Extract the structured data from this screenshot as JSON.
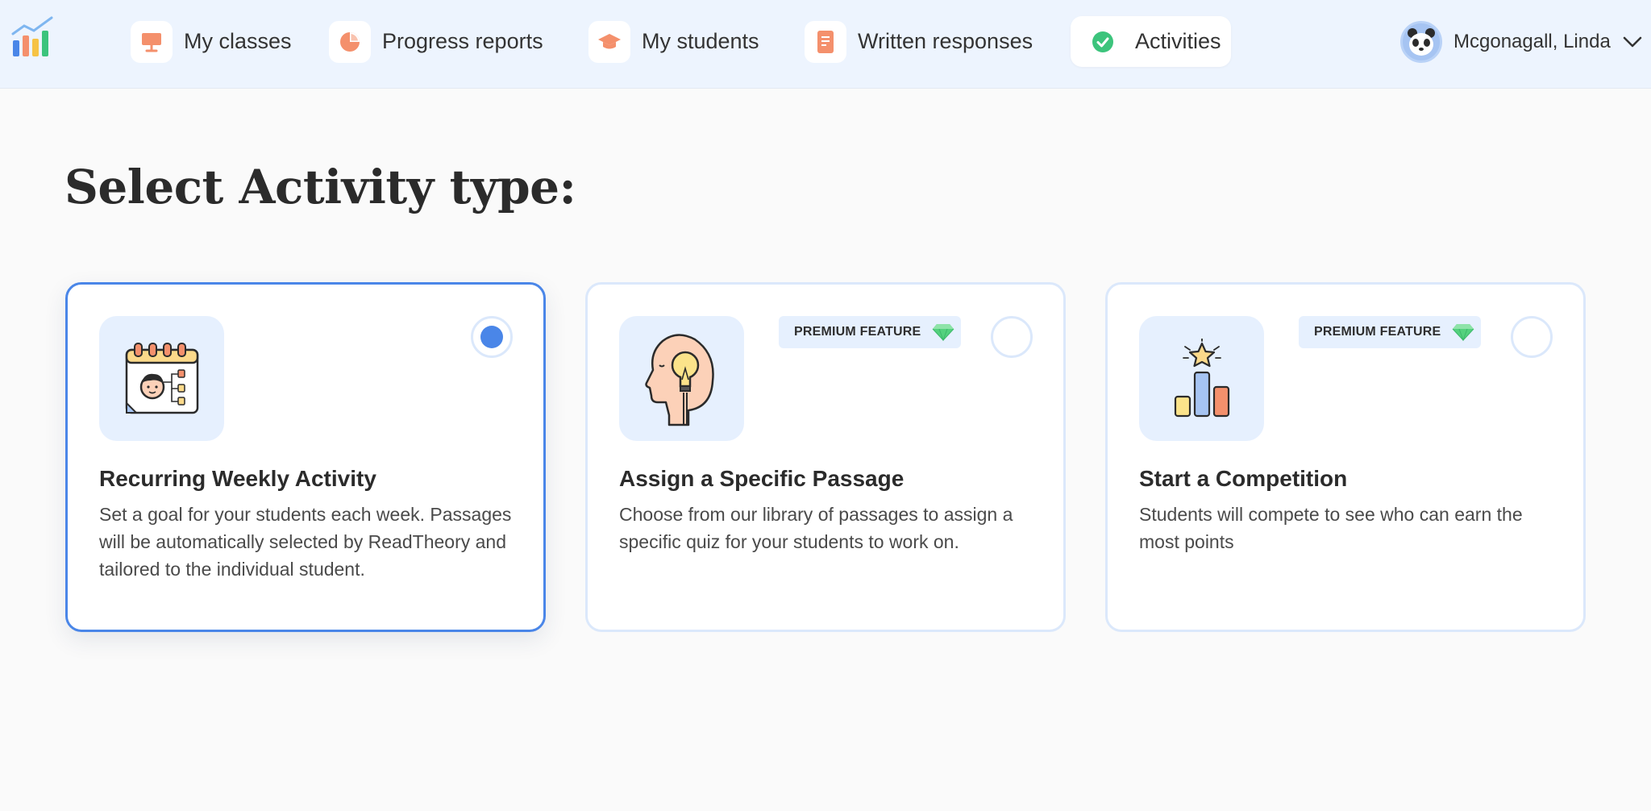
{
  "nav": {
    "items": [
      {
        "label": "My classes",
        "icon": "presentation-board-icon"
      },
      {
        "label": "Progress reports",
        "icon": "pie-chart-icon"
      },
      {
        "label": "My students",
        "icon": "graduation-cap-icon"
      },
      {
        "label": "Written responses",
        "icon": "document-icon"
      },
      {
        "label": "Activities",
        "icon": "check-circle-icon",
        "active": true
      }
    ],
    "user_name": "Mcgonagall, Linda"
  },
  "page": {
    "title": "Select Activity type:"
  },
  "cards": [
    {
      "title": "Recurring Weekly Activity",
      "description": "Set a goal for your students each week. Passages will be automatically selected by ReadTheory and tailored to the individual student.",
      "selected": true,
      "icon": "calendar-student-icon"
    },
    {
      "title": "Assign a Specific Passage",
      "description": "Choose from our library of passages to assign a specific quiz for your students to work on.",
      "badge": "PREMIUM FEATURE",
      "selected": false,
      "icon": "head-lightbulb-icon"
    },
    {
      "title": "Start a Competition",
      "description": "Students will compete to see who can earn the most points",
      "badge": "PREMIUM FEATURE",
      "selected": false,
      "icon": "podium-star-icon"
    }
  ],
  "colors": {
    "accent": "#4a86e8",
    "nav_bg": "#edf4fe",
    "icon_orange": "#f4906c",
    "check_green": "#3cc47c",
    "gem_green": "#54d17e"
  }
}
